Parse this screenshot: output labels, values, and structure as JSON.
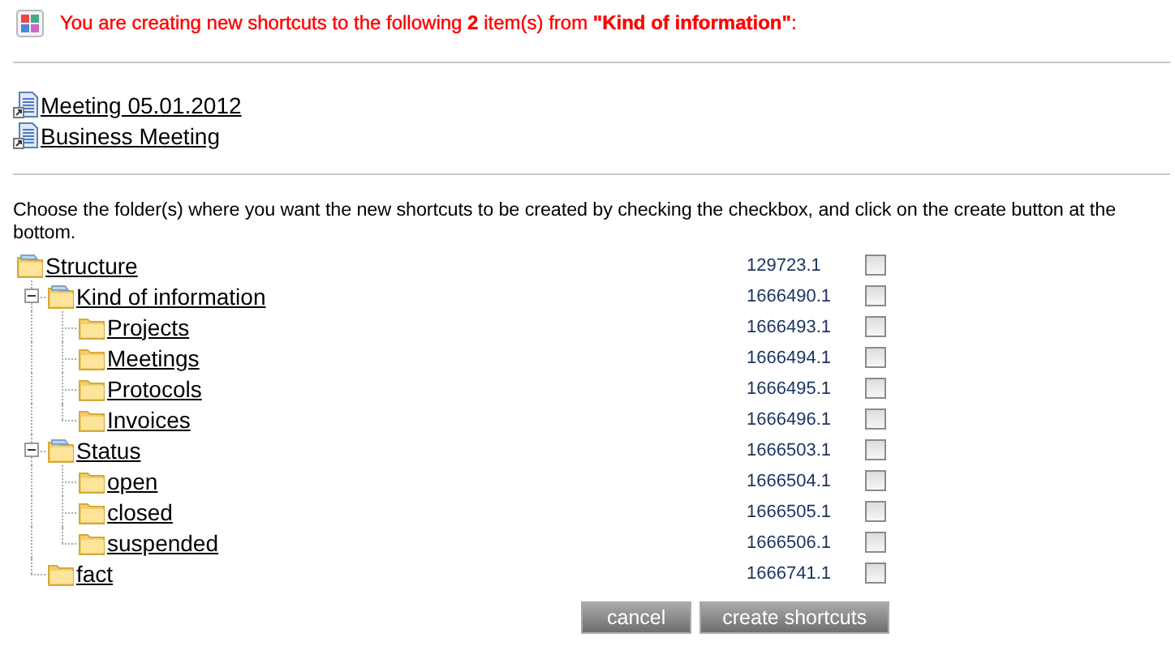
{
  "header": {
    "message": "You are creating new shortcuts to the following **2** item(s) from **\"Kind of information\"**:"
  },
  "items": [
    {
      "label": "Meeting 05.01.2012"
    },
    {
      "label": "Business Meeting"
    }
  ],
  "instructions": "Choose the folder(s) where you want the new shortcuts to be created by checking the checkbox, and click on the create button at the bottom.",
  "tree": [
    {
      "label": "Structure",
      "id": "129723.1",
      "checked": false,
      "expanded": true,
      "children": [
        {
          "label": "Kind of information",
          "id": "1666490.1",
          "checked": false,
          "expanded": true,
          "children": [
            {
              "label": "Projects",
              "id": "1666493.1",
              "checked": false
            },
            {
              "label": "Meetings",
              "id": "1666494.1",
              "checked": false
            },
            {
              "label": "Protocols",
              "id": "1666495.1",
              "checked": false
            },
            {
              "label": "Invoices",
              "id": "1666496.1",
              "checked": false
            }
          ]
        },
        {
          "label": "Status",
          "id": "1666503.1",
          "checked": false,
          "expanded": true,
          "children": [
            {
              "label": "open",
              "id": "1666504.1",
              "checked": false
            },
            {
              "label": "closed",
              "id": "1666505.1",
              "checked": false
            },
            {
              "label": "suspended",
              "id": "1666506.1",
              "checked": false
            }
          ]
        },
        {
          "label": "fact",
          "id": "1666741.1",
          "checked": false
        }
      ]
    }
  ],
  "buttons": [
    {
      "label": "cancel"
    },
    {
      "label": "create shortcuts"
    }
  ]
}
